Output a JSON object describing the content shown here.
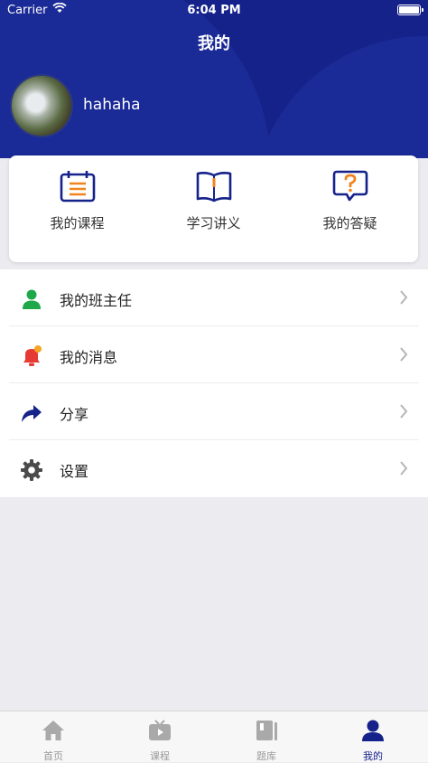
{
  "status_bar": {
    "carrier": "Carrier",
    "time": "6:04 PM"
  },
  "header": {
    "title": "我的",
    "username": "hahaha"
  },
  "quick_actions": [
    {
      "label": "我的课程",
      "icon": "calendar-list-icon"
    },
    {
      "label": "学习讲义",
      "icon": "open-book-icon"
    },
    {
      "label": "我的答疑",
      "icon": "question-bubble-icon"
    }
  ],
  "menu": [
    {
      "label": "我的班主任",
      "icon": "person-icon"
    },
    {
      "label": "我的消息",
      "icon": "bell-icon"
    },
    {
      "label": "分享",
      "icon": "share-arrow-icon"
    },
    {
      "label": "设置",
      "icon": "gear-icon"
    }
  ],
  "tabs": [
    {
      "label": "首页",
      "icon": "home-icon",
      "active": false
    },
    {
      "label": "课程",
      "icon": "tv-icon",
      "active": false
    },
    {
      "label": "题库",
      "icon": "book-icon",
      "active": false
    },
    {
      "label": "我的",
      "icon": "user-icon",
      "active": true
    }
  ],
  "colors": {
    "header_bg": "#15228a",
    "accent": "#15228a",
    "icon_orange": "#f0841f",
    "person_green": "#1fa84a",
    "bell_red": "#e63a35"
  }
}
